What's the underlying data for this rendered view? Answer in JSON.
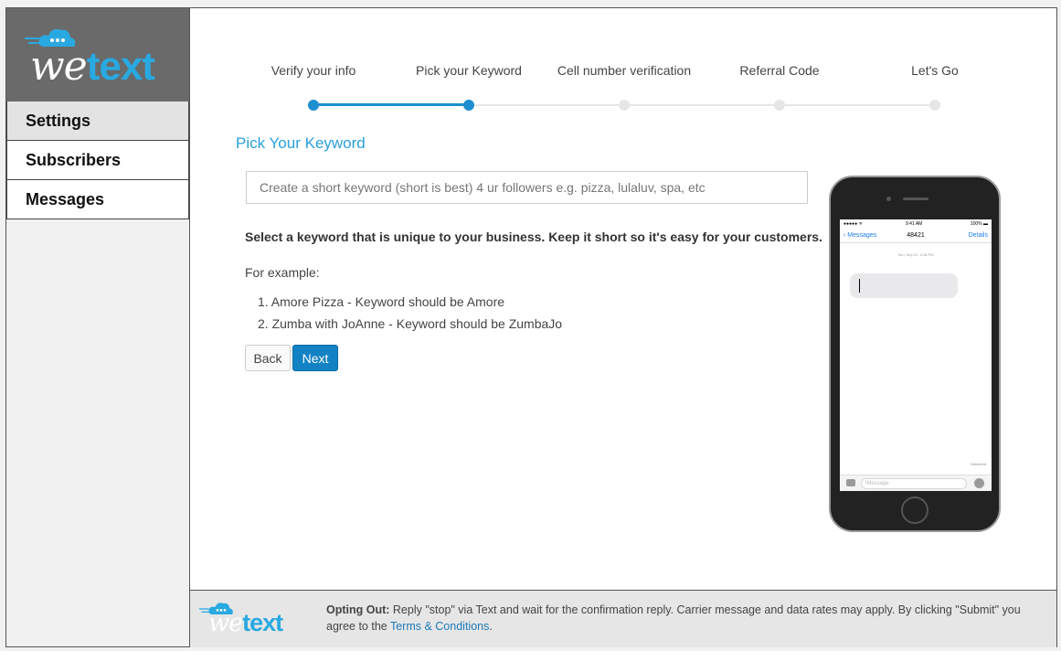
{
  "brand": {
    "logo_we": "we",
    "logo_text": "text",
    "accent": "#29a9e1"
  },
  "sidebar": {
    "items": [
      {
        "label": "Settings",
        "active": true
      },
      {
        "label": "Subscribers",
        "active": false
      },
      {
        "label": "Messages",
        "active": false
      }
    ]
  },
  "steps": [
    {
      "label": "Verify your info",
      "done": true
    },
    {
      "label": "Pick your Keyword",
      "done": true
    },
    {
      "label": "Cell number verification",
      "done": false
    },
    {
      "label": "Referral Code",
      "done": false
    },
    {
      "label": "Let's Go",
      "done": false
    }
  ],
  "main": {
    "title": "Pick Your Keyword",
    "keyword_placeholder": "Create a short keyword (short is best) 4 ur followers e.g. pizza, lulaluv, spa, etc",
    "keyword_value": "",
    "instruction": "Select a keyword that is unique to your business. Keep it short so it's easy for your customers.",
    "example_heading": "For example:",
    "examples": [
      "1. Amore Pizza - Keyword should be Amore",
      "2. Zumba with JoAnne - Keyword should be ZumbaJo"
    ],
    "back_label": "Back",
    "next_label": "Next"
  },
  "phone": {
    "time": "9:41 AM",
    "battery": "100%",
    "back_label": "Messages",
    "number": "48421",
    "details_label": "Details",
    "date": "Sun, Sep 22, 4:18 PM",
    "delivered": "Delivered",
    "input_placeholder": "iMessage"
  },
  "footer": {
    "opt_out_label": "Opting Out:",
    "opt_out_text": " Reply \"stop\" via Text and wait for the confirmation reply. Carrier message and data rates may apply. By clicking \"Submit\" you agree to the ",
    "terms_label": "Terms & Conditions",
    "terms_suffix": "."
  }
}
